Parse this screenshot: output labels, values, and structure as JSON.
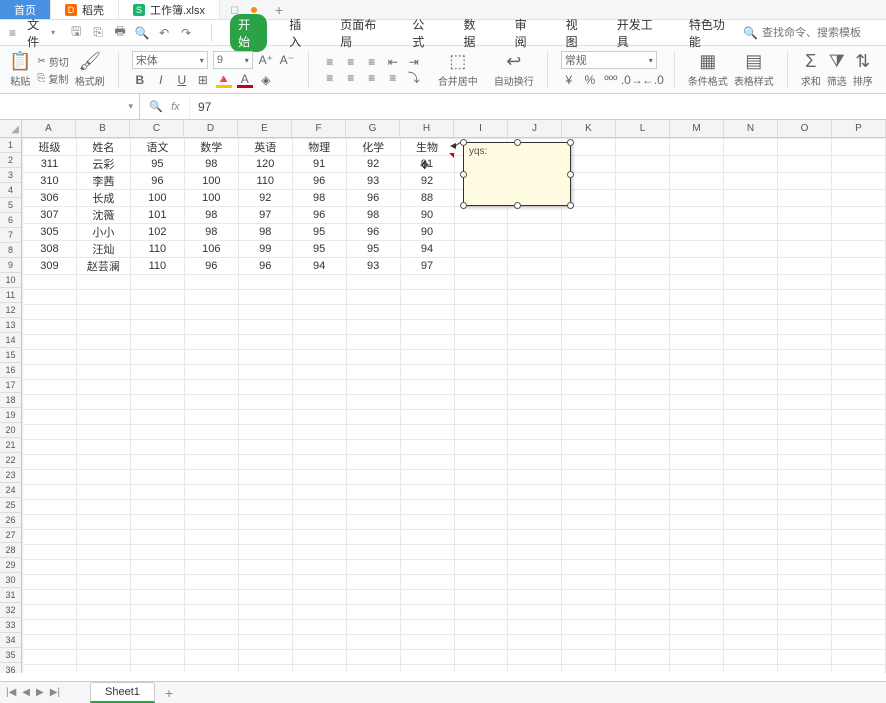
{
  "tabs": {
    "home": "首页",
    "wps": "稻壳",
    "file": "工作簿.xlsx"
  },
  "menu": {
    "file_label": "文件",
    "ribbon": [
      "开始",
      "插入",
      "页面布局",
      "公式",
      "数据",
      "审阅",
      "视图",
      "开发工具",
      "特色功能"
    ],
    "search_placeholder": "查找命令、搜索模板"
  },
  "toolbar": {
    "paste": "粘贴",
    "cut": "剪切",
    "copy": "复制",
    "format_painter": "格式刷",
    "font_name": "宋体",
    "font_size": "9",
    "merge_center": "合并居中",
    "auto_wrap": "自动换行",
    "number_format": "常规",
    "cond_format": "条件格式",
    "table_style": "表格样式",
    "sum": "求和",
    "filter": "筛选",
    "sort": "排序"
  },
  "formula_bar": {
    "name_box": "",
    "fx": "fx",
    "value": "97"
  },
  "columns": [
    "A",
    "B",
    "C",
    "D",
    "E",
    "F",
    "G",
    "H",
    "I",
    "J",
    "K",
    "L",
    "M",
    "N",
    "O",
    "P"
  ],
  "headers": [
    "班级",
    "姓名",
    "语文",
    "数学",
    "英语",
    "物理",
    "化学",
    "生物"
  ],
  "rows": [
    {
      "r": [
        "311",
        "云彩",
        "95",
        "98",
        "120",
        "91",
        "92",
        "91"
      ]
    },
    {
      "r": [
        "310",
        "李茜",
        "96",
        "100",
        "110",
        "96",
        "93",
        "92"
      ]
    },
    {
      "r": [
        "306",
        "长成",
        "100",
        "100",
        "92",
        "98",
        "96",
        "88"
      ]
    },
    {
      "r": [
        "307",
        "沈薇",
        "101",
        "98",
        "97",
        "96",
        "98",
        "90"
      ]
    },
    {
      "r": [
        "305",
        "小小",
        "102",
        "98",
        "98",
        "95",
        "96",
        "90"
      ]
    },
    {
      "r": [
        "308",
        "汪灿",
        "110",
        "106",
        "99",
        "95",
        "95",
        "94"
      ]
    },
    {
      "r": [
        "309",
        "赵芸澜",
        "110",
        "96",
        "96",
        "94",
        "93",
        "97"
      ]
    }
  ],
  "comment": {
    "author": "yqs:"
  },
  "sheet_tabs": {
    "sheet1": "Sheet1"
  }
}
